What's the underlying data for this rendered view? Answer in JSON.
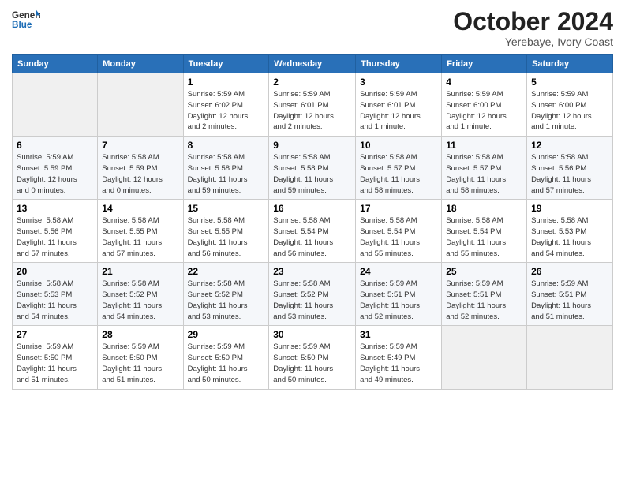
{
  "logo": {
    "general": "General",
    "blue": "Blue"
  },
  "header": {
    "month": "October 2024",
    "location": "Yerebaye, Ivory Coast"
  },
  "weekdays": [
    "Sunday",
    "Monday",
    "Tuesday",
    "Wednesday",
    "Thursday",
    "Friday",
    "Saturday"
  ],
  "weeks": [
    [
      {
        "day": "",
        "info": ""
      },
      {
        "day": "",
        "info": ""
      },
      {
        "day": "1",
        "info": "Sunrise: 5:59 AM\nSunset: 6:02 PM\nDaylight: 12 hours\nand 2 minutes."
      },
      {
        "day": "2",
        "info": "Sunrise: 5:59 AM\nSunset: 6:01 PM\nDaylight: 12 hours\nand 2 minutes."
      },
      {
        "day": "3",
        "info": "Sunrise: 5:59 AM\nSunset: 6:01 PM\nDaylight: 12 hours\nand 1 minute."
      },
      {
        "day": "4",
        "info": "Sunrise: 5:59 AM\nSunset: 6:00 PM\nDaylight: 12 hours\nand 1 minute."
      },
      {
        "day": "5",
        "info": "Sunrise: 5:59 AM\nSunset: 6:00 PM\nDaylight: 12 hours\nand 1 minute."
      }
    ],
    [
      {
        "day": "6",
        "info": "Sunrise: 5:59 AM\nSunset: 5:59 PM\nDaylight: 12 hours\nand 0 minutes."
      },
      {
        "day": "7",
        "info": "Sunrise: 5:58 AM\nSunset: 5:59 PM\nDaylight: 12 hours\nand 0 minutes."
      },
      {
        "day": "8",
        "info": "Sunrise: 5:58 AM\nSunset: 5:58 PM\nDaylight: 11 hours\nand 59 minutes."
      },
      {
        "day": "9",
        "info": "Sunrise: 5:58 AM\nSunset: 5:58 PM\nDaylight: 11 hours\nand 59 minutes."
      },
      {
        "day": "10",
        "info": "Sunrise: 5:58 AM\nSunset: 5:57 PM\nDaylight: 11 hours\nand 58 minutes."
      },
      {
        "day": "11",
        "info": "Sunrise: 5:58 AM\nSunset: 5:57 PM\nDaylight: 11 hours\nand 58 minutes."
      },
      {
        "day": "12",
        "info": "Sunrise: 5:58 AM\nSunset: 5:56 PM\nDaylight: 11 hours\nand 57 minutes."
      }
    ],
    [
      {
        "day": "13",
        "info": "Sunrise: 5:58 AM\nSunset: 5:56 PM\nDaylight: 11 hours\nand 57 minutes."
      },
      {
        "day": "14",
        "info": "Sunrise: 5:58 AM\nSunset: 5:55 PM\nDaylight: 11 hours\nand 57 minutes."
      },
      {
        "day": "15",
        "info": "Sunrise: 5:58 AM\nSunset: 5:55 PM\nDaylight: 11 hours\nand 56 minutes."
      },
      {
        "day": "16",
        "info": "Sunrise: 5:58 AM\nSunset: 5:54 PM\nDaylight: 11 hours\nand 56 minutes."
      },
      {
        "day": "17",
        "info": "Sunrise: 5:58 AM\nSunset: 5:54 PM\nDaylight: 11 hours\nand 55 minutes."
      },
      {
        "day": "18",
        "info": "Sunrise: 5:58 AM\nSunset: 5:54 PM\nDaylight: 11 hours\nand 55 minutes."
      },
      {
        "day": "19",
        "info": "Sunrise: 5:58 AM\nSunset: 5:53 PM\nDaylight: 11 hours\nand 54 minutes."
      }
    ],
    [
      {
        "day": "20",
        "info": "Sunrise: 5:58 AM\nSunset: 5:53 PM\nDaylight: 11 hours\nand 54 minutes."
      },
      {
        "day": "21",
        "info": "Sunrise: 5:58 AM\nSunset: 5:52 PM\nDaylight: 11 hours\nand 54 minutes."
      },
      {
        "day": "22",
        "info": "Sunrise: 5:58 AM\nSunset: 5:52 PM\nDaylight: 11 hours\nand 53 minutes."
      },
      {
        "day": "23",
        "info": "Sunrise: 5:58 AM\nSunset: 5:52 PM\nDaylight: 11 hours\nand 53 minutes."
      },
      {
        "day": "24",
        "info": "Sunrise: 5:59 AM\nSunset: 5:51 PM\nDaylight: 11 hours\nand 52 minutes."
      },
      {
        "day": "25",
        "info": "Sunrise: 5:59 AM\nSunset: 5:51 PM\nDaylight: 11 hours\nand 52 minutes."
      },
      {
        "day": "26",
        "info": "Sunrise: 5:59 AM\nSunset: 5:51 PM\nDaylight: 11 hours\nand 51 minutes."
      }
    ],
    [
      {
        "day": "27",
        "info": "Sunrise: 5:59 AM\nSunset: 5:50 PM\nDaylight: 11 hours\nand 51 minutes."
      },
      {
        "day": "28",
        "info": "Sunrise: 5:59 AM\nSunset: 5:50 PM\nDaylight: 11 hours\nand 51 minutes."
      },
      {
        "day": "29",
        "info": "Sunrise: 5:59 AM\nSunset: 5:50 PM\nDaylight: 11 hours\nand 50 minutes."
      },
      {
        "day": "30",
        "info": "Sunrise: 5:59 AM\nSunset: 5:50 PM\nDaylight: 11 hours\nand 50 minutes."
      },
      {
        "day": "31",
        "info": "Sunrise: 5:59 AM\nSunset: 5:49 PM\nDaylight: 11 hours\nand 49 minutes."
      },
      {
        "day": "",
        "info": ""
      },
      {
        "day": "",
        "info": ""
      }
    ]
  ]
}
